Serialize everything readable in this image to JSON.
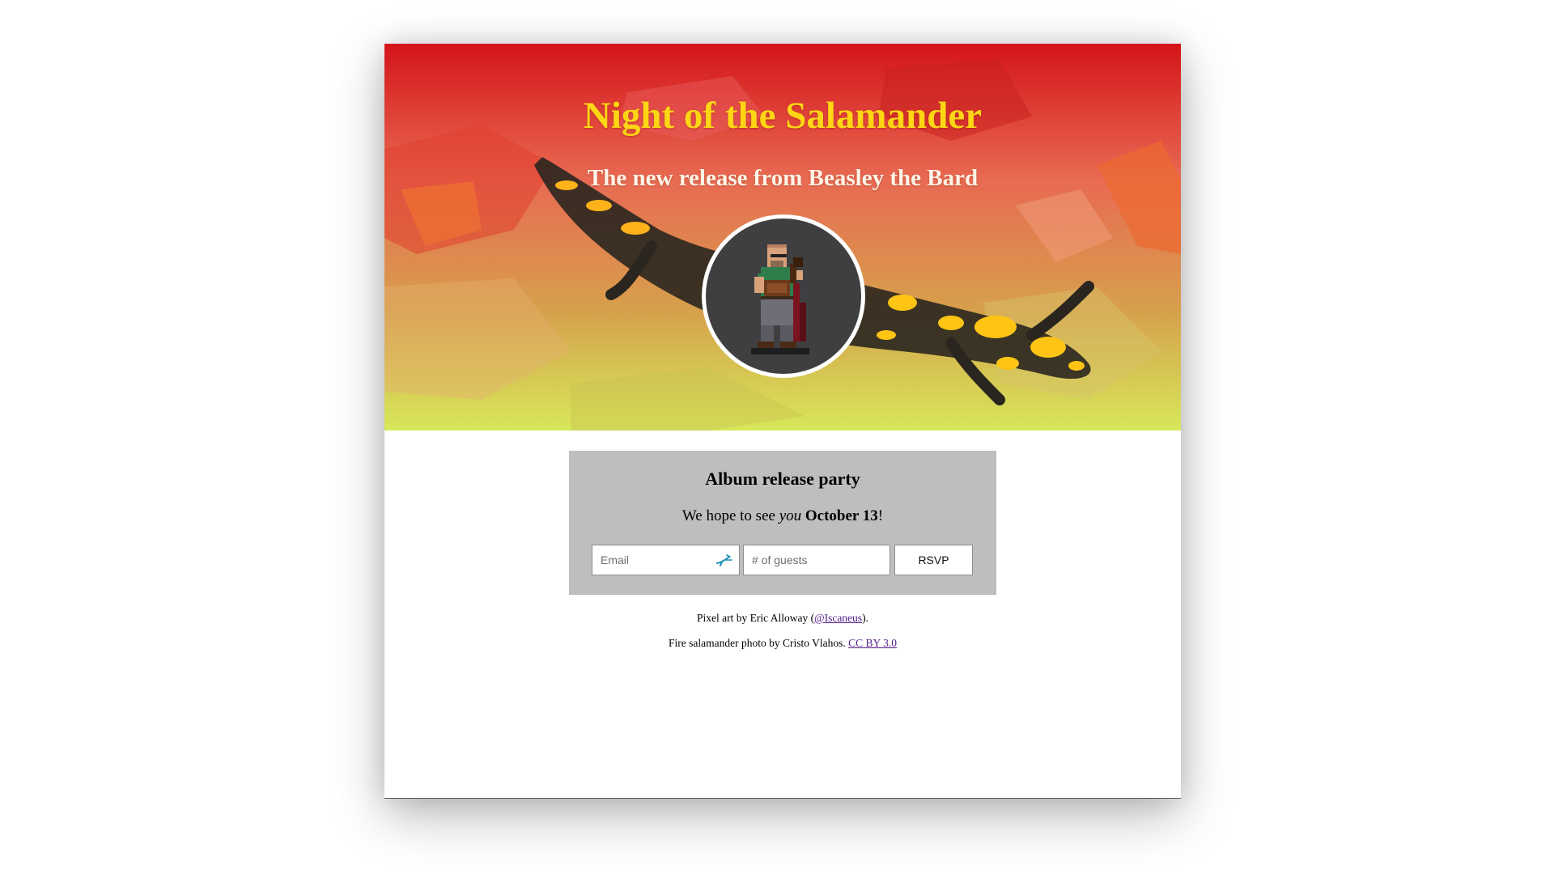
{
  "hero": {
    "title": "Night of the Salamander",
    "subtitle": "The new release from Beasley the Bard",
    "gradient_top_color": "#d4141a",
    "gradient_bottom_color": "#d7e85a",
    "title_color": "#ffd614"
  },
  "party": {
    "heading": "Album release party",
    "text_before": "We hope to see ",
    "text_emphasis": "you",
    "text_between": " ",
    "text_date": "October 13",
    "text_after": "!",
    "email_placeholder": "Email",
    "guests_placeholder": "# of guests",
    "rsvp_label": "RSVP",
    "card_color": "#bebebe"
  },
  "credits": {
    "pixel_art_prefix": "Pixel art by Eric Alloway (",
    "pixel_art_link": "@Iscaneus",
    "pixel_art_suffix": ").",
    "photo_prefix": "Fire salamander photo by Cristo Vlahos. ",
    "photo_link": "CC BY 3.0",
    "link_color": "#551a8b"
  },
  "icons": {
    "avatar": "bard-pixel-art-icon",
    "autofill": "password-autofill-icon",
    "hero_background": "fire-salamander-photo"
  }
}
